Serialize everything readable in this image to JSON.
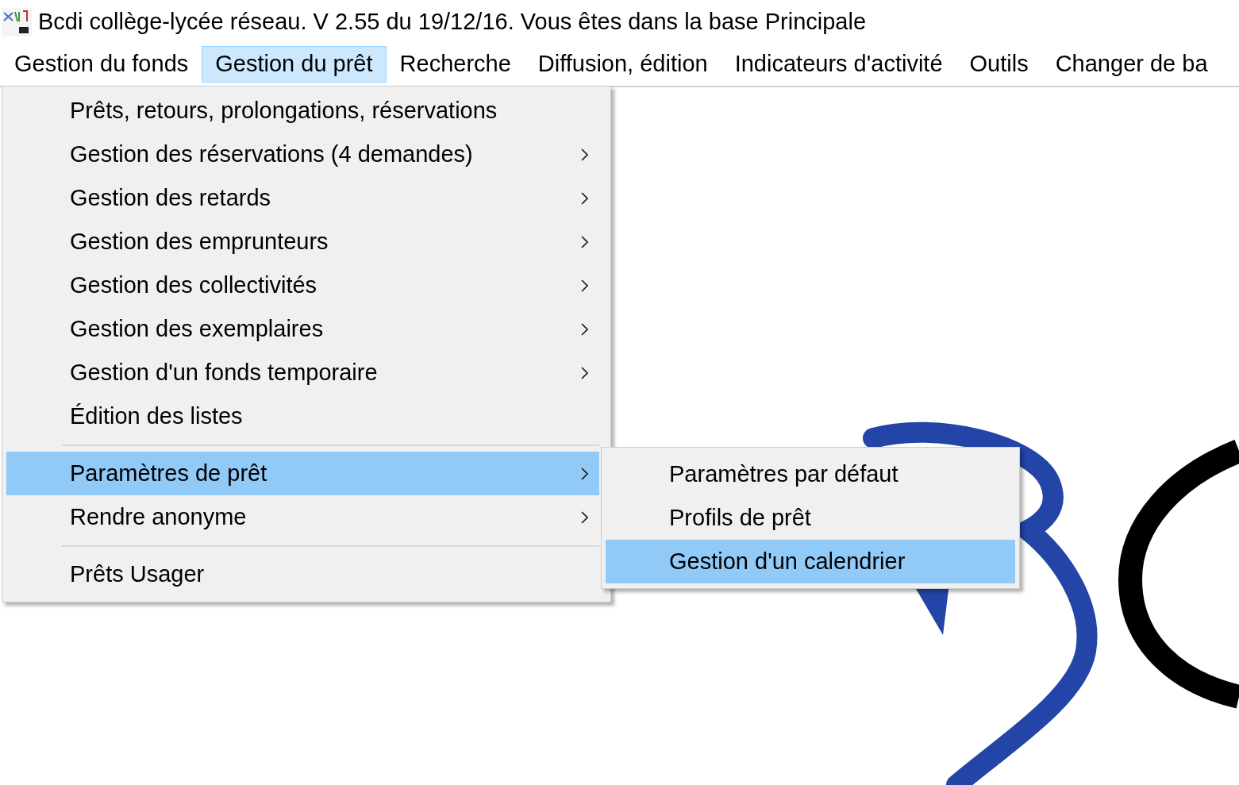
{
  "window": {
    "title": "Bcdi collège-lycée réseau. V 2.55 du 19/12/16. Vous êtes dans la base Principale"
  },
  "menu_bar": [
    {
      "label": "Gestion du fonds",
      "selected": false
    },
    {
      "label": "Gestion du prêt",
      "selected": true
    },
    {
      "label": "Recherche",
      "selected": false
    },
    {
      "label": "Diffusion, édition",
      "selected": false
    },
    {
      "label": "Indicateurs d'activité",
      "selected": false
    },
    {
      "label": "Outils",
      "selected": false
    },
    {
      "label": "Changer de ba",
      "selected": false
    }
  ],
  "dropdown_menu": {
    "items": [
      {
        "kind": "item",
        "label": "Prêts, retours, prolongations, réservations",
        "has_submenu": false,
        "selected": false
      },
      {
        "kind": "item",
        "label": "Gestion des réservations (4 demandes)",
        "has_submenu": true,
        "selected": false
      },
      {
        "kind": "item",
        "label": "Gestion des retards",
        "has_submenu": true,
        "selected": false
      },
      {
        "kind": "item",
        "label": "Gestion des emprunteurs",
        "has_submenu": true,
        "selected": false
      },
      {
        "kind": "item",
        "label": "Gestion des collectivités",
        "has_submenu": true,
        "selected": false
      },
      {
        "kind": "item",
        "label": "Gestion des exemplaires",
        "has_submenu": true,
        "selected": false
      },
      {
        "kind": "item",
        "label": "Gestion d'un fonds temporaire",
        "has_submenu": true,
        "selected": false
      },
      {
        "kind": "item",
        "label": "Édition des listes",
        "has_submenu": false,
        "selected": false
      },
      {
        "kind": "separator"
      },
      {
        "kind": "item",
        "label": "Paramètres de prêt",
        "has_submenu": true,
        "selected": true
      },
      {
        "kind": "item",
        "label": "Rendre anonyme",
        "has_submenu": true,
        "selected": false
      },
      {
        "kind": "separator"
      },
      {
        "kind": "item",
        "label": "Prêts Usager",
        "has_submenu": false,
        "selected": false
      }
    ]
  },
  "submenu": {
    "items": [
      {
        "label": "Paramètres par défaut",
        "selected": false
      },
      {
        "label": "Profils de prêt",
        "selected": false
      },
      {
        "label": "Gestion d'un calendrier",
        "selected": true
      }
    ]
  }
}
